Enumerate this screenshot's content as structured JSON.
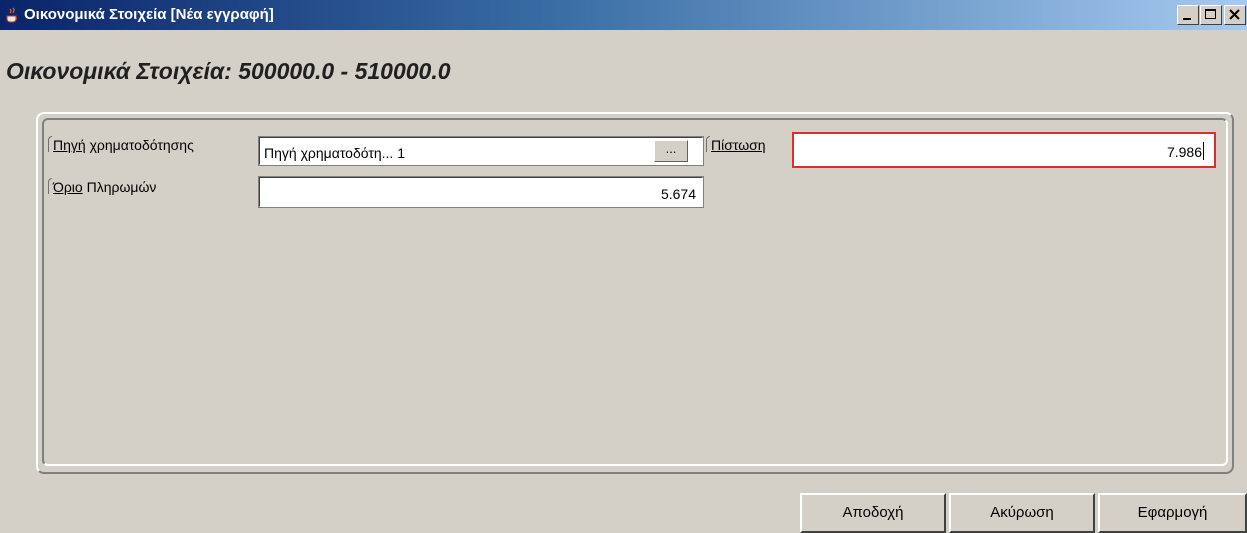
{
  "window": {
    "title": "Οικονομικά Στοιχεία [Νέα εγγραφή]",
    "app_icon": "java-cup-icon",
    "controls": [
      "minimize-icon",
      "maximize-icon",
      "close-icon"
    ]
  },
  "heading": "Οικονομικά Στοιχεία: 500000.0 - 510000.0",
  "form": {
    "funding_source": {
      "label_mnemonic": "Πηγή",
      "label_rest": " χρηματοδότησης",
      "value": "Πηγή χρηματοδότη...  1",
      "browse_label": "..."
    },
    "credit": {
      "label_mnemonic": "Πίστωση",
      "value": "7.986"
    },
    "payment_limit": {
      "label_mnemonic": "Όριο",
      "label_rest": " Πληρωμών",
      "value": "5.674"
    }
  },
  "buttons": {
    "accept": "Αποδοχή",
    "cancel": "Ακύρωση",
    "apply": "Εφαρμογή"
  },
  "colors": {
    "title_start": "#0a246a",
    "title_end": "#a6caf0",
    "error_border": "#d83030",
    "window_bg": "#d4d0c8"
  }
}
